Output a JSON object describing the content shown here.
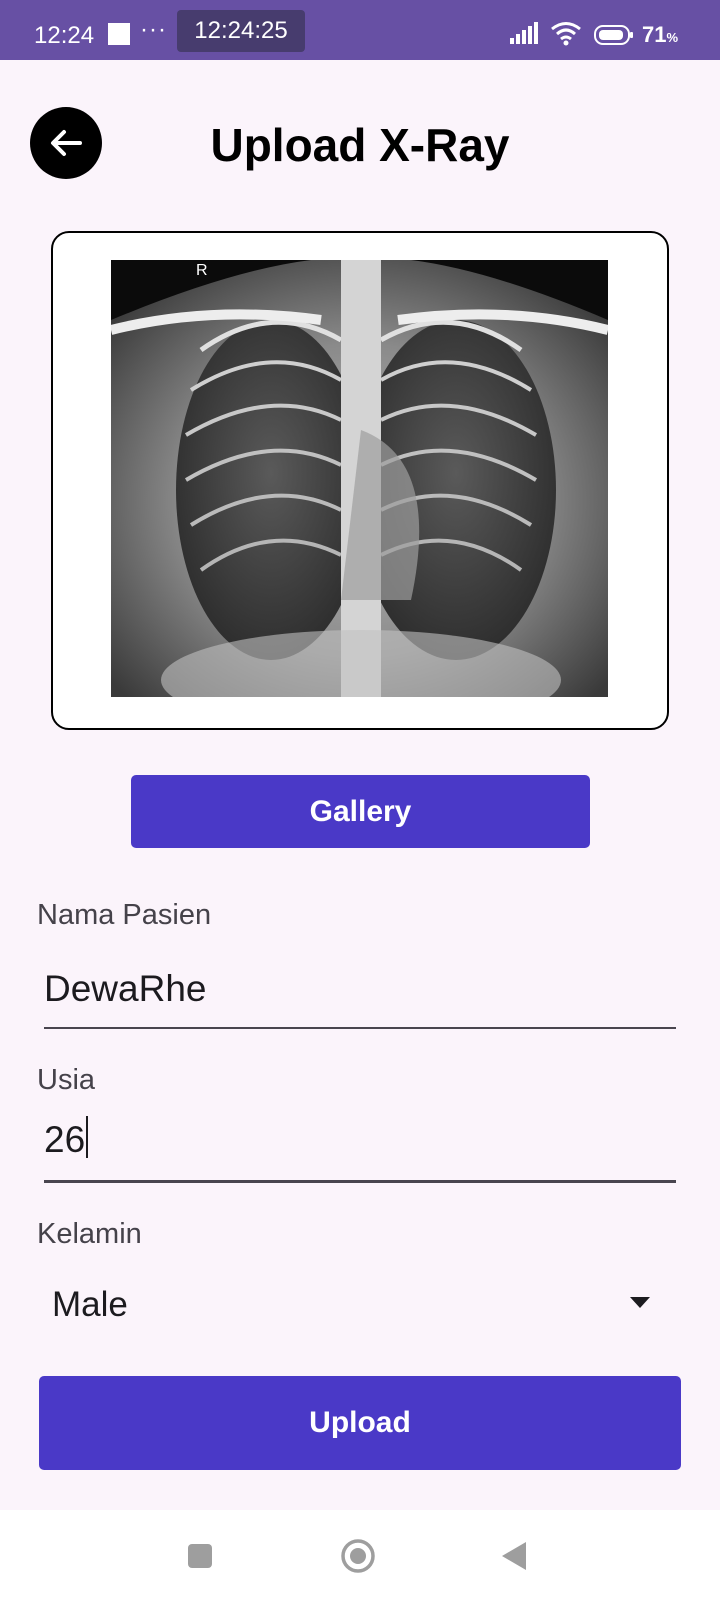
{
  "status_bar": {
    "time": "12:24",
    "chip_time": "12:24:25",
    "dots": "···",
    "battery_percent": "71",
    "battery_unit": "%",
    "icons": [
      "notification-square-icon",
      "signal-icon",
      "wifi-icon",
      "battery-icon"
    ]
  },
  "header": {
    "title": "Upload X-Ray",
    "back_icon": "arrow-left-icon"
  },
  "image_preview": {
    "marker": "R"
  },
  "buttons": {
    "gallery_label": "Gallery",
    "upload_label": "Upload"
  },
  "form": {
    "name": {
      "label": "Nama Pasien",
      "value": "DewaRhe"
    },
    "age": {
      "label": "Usia",
      "value": "26"
    },
    "gender": {
      "label": "Kelamin",
      "value": "Male",
      "icon": "dropdown-arrow-icon"
    }
  },
  "nav_bar": {
    "icons": [
      "recents-square-icon",
      "home-circle-icon",
      "back-triangle-icon"
    ]
  },
  "colors": {
    "status_bar": "#6750a4",
    "background": "#fbf4fb",
    "primary_button": "#4a39c7"
  }
}
